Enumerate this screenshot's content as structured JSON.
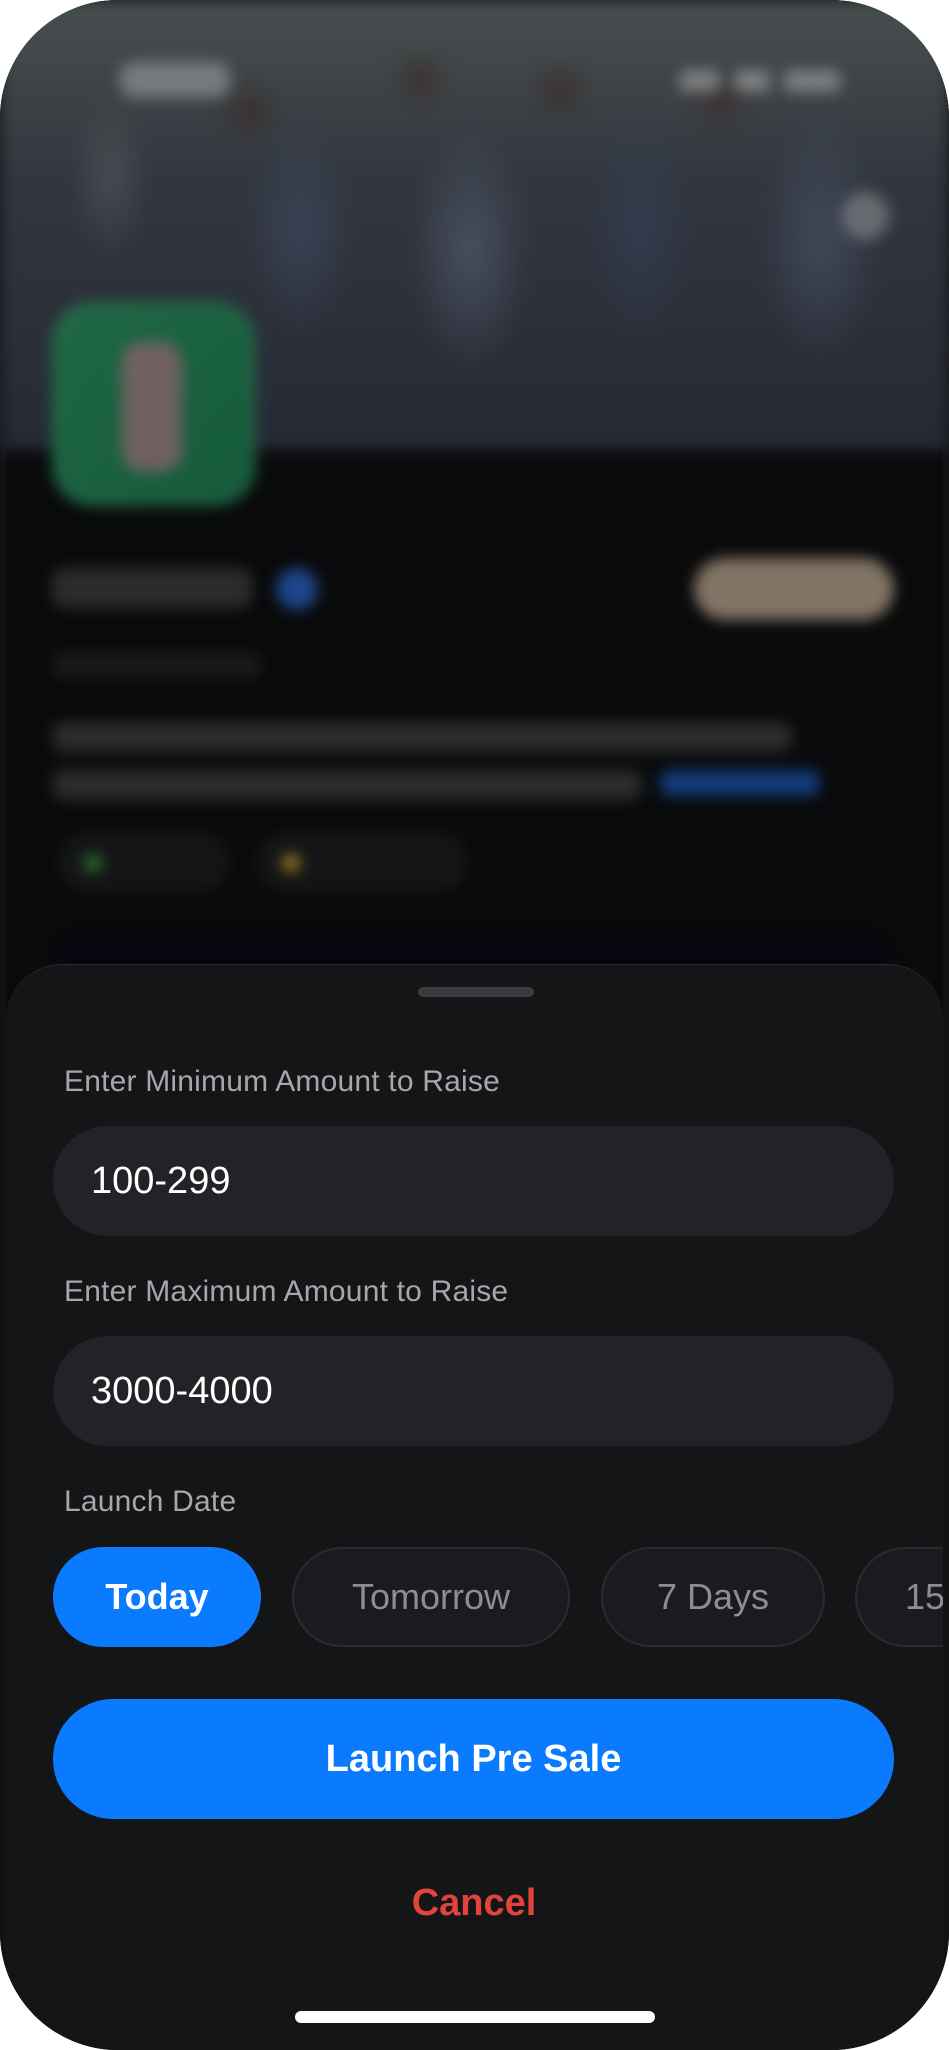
{
  "form": {
    "min_label": "Enter Minimum Amount to Raise",
    "min_value": "100-299",
    "max_label": "Enter Maximum Amount to Raise",
    "max_value": "3000-4000",
    "launch_date_label": "Launch Date",
    "date_options": [
      {
        "label": "Today",
        "selected": true
      },
      {
        "label": "Tomorrow",
        "selected": false
      },
      {
        "label": "7 Days",
        "selected": false
      },
      {
        "label": "15",
        "selected": false
      }
    ]
  },
  "actions": {
    "launch_label": "Launch Pre Sale",
    "cancel_label": "Cancel"
  },
  "colors": {
    "accent": "#0a7bff",
    "danger": "#e2443b",
    "sheet_bg": "#141517",
    "field_bg": "#222327"
  }
}
